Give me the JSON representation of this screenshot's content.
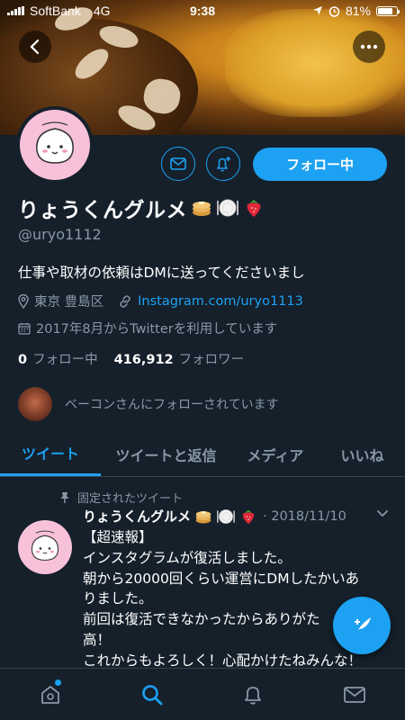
{
  "status_bar": {
    "carrier": "SoftBank",
    "network": "4G",
    "time": "9:38",
    "battery": "81%",
    "battery_level": 0.81
  },
  "profile": {
    "display_name": "りょうくんグルメ",
    "name_emojis": [
      "pancake-emoji",
      "plate-emoji",
      "strawberry-emoji"
    ],
    "handle": "@uryo1112",
    "bio": "仕事や取材の依頼はDMに送ってくださいまし",
    "location": "東京 豊島区",
    "link": "Instagram.com/uryo1113",
    "joined": "2017年8月からTwitterを利用しています",
    "following_count": "0",
    "following_label": "フォロー中",
    "followers_count": "416,912",
    "followers_label": "フォロワー",
    "followed_by": "ベーコンさんにフォローされています"
  },
  "actions": {
    "follow_button": "フォロー中"
  },
  "tabs": [
    {
      "label": "ツイート",
      "active": true
    },
    {
      "label": "ツイートと返信",
      "active": false
    },
    {
      "label": "メディア",
      "active": false
    },
    {
      "label": "いいね",
      "active": false
    }
  ],
  "tweet": {
    "pinned_label": "固定されたツイート",
    "author": "りょうくんグルメ",
    "date": "· 2018/11/10",
    "lines": [
      "【超速報】",
      "インスタグラムが復活しました。",
      "朝から20000回くらい運営にDMしたかいあ",
      "りました。",
      "前回は復活できなかったからありがた",
      "高！",
      "これからもよろしく！心配かけたねみんな！"
    ]
  },
  "colors": {
    "background": "#15202b",
    "accent": "#1da1f2",
    "secondary_text": "#8899a6",
    "divider": "#38444d"
  },
  "bottom_nav": [
    "home-icon",
    "search-icon",
    "notifications-icon",
    "messages-icon"
  ]
}
